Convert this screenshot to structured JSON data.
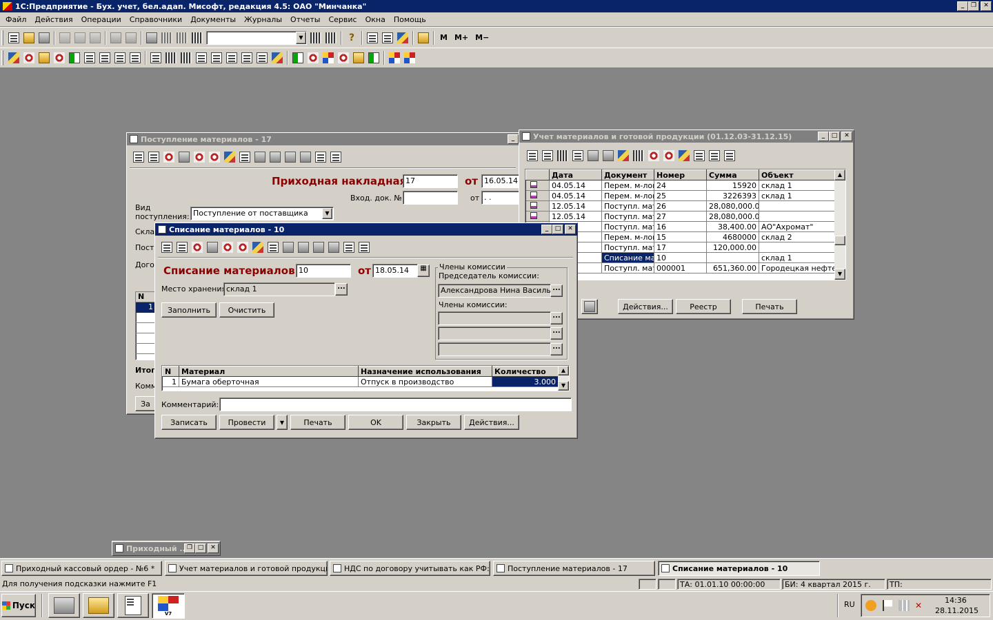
{
  "app": {
    "title": "1С:Предприятие - Бух. учет, бел.адап. Мисофт, редакция 4.5: ОАО \"Минчанка\"",
    "menu": [
      "Файл",
      "Действия",
      "Операции",
      "Справочники",
      "Документы",
      "Журналы",
      "Отчеты",
      "Сервис",
      "Окна",
      "Помощь"
    ],
    "toolbar_text": {
      "m": "M",
      "m_plus": "M+",
      "m_minus": "M−"
    }
  },
  "receipt_window": {
    "title": "Поступление материалов - 17",
    "heading": "Приходная накладная №",
    "number": "17",
    "from_label": "от",
    "date": "16.05.14",
    "incoming_doc_label": "Вход. док. №",
    "incoming_from_label": "от",
    "incoming_date": ". .",
    "kind_label_1": "Вид",
    "kind_label_2": "поступления:",
    "kind_value": "Поступление от поставщика",
    "sklad_label": "Скла",
    "post_label": "Пост",
    "dogo_label": "Дого",
    "n_header": "N",
    "row1": "1",
    "itog_label": "Итог",
    "komm_label": "Комм",
    "za_label": "За"
  },
  "journal_window": {
    "title": "Учет материалов и готовой продукции (01.12.03-31.12.15)",
    "columns": [
      "Дата",
      "Документ",
      "Номер",
      "Сумма",
      "Объект"
    ],
    "rows": [
      {
        "date": "04.05.14",
        "doc": "Перем. м-лов",
        "num": "24",
        "sum": "15920",
        "obj": "склад 1"
      },
      {
        "date": "04.05.14",
        "doc": "Перем. м-лов",
        "num": "25",
        "sum": "3226393",
        "obj": "склад 1"
      },
      {
        "date": "12.05.14",
        "doc": "Поступл. мате",
        "num": "26",
        "sum": "28,080,000.00",
        "obj": ""
      },
      {
        "date": "12.05.14",
        "doc": "Поступл. мате",
        "num": "27",
        "sum": "28,080,000.00",
        "obj": ""
      },
      {
        "date": "",
        "doc": "Поступл. мате",
        "num": "16",
        "sum": "38,400.00",
        "obj": "АО\"Ахромат\""
      },
      {
        "date": "",
        "doc": "Перем. м-лов",
        "num": "15",
        "sum": "4680000",
        "obj": "склад 2"
      },
      {
        "date": "",
        "doc": "Поступл. мате",
        "num": "17",
        "sum": "120,000.00",
        "obj": ""
      },
      {
        "date": "",
        "doc": "Списание мат",
        "num": "10",
        "sum": "",
        "obj": "склад 1"
      },
      {
        "date": "",
        "doc": "Поступл. мате",
        "num": "000001",
        "sum": "651,360.00",
        "obj": "Городецкая нефтеба"
      }
    ],
    "selected_row": 7,
    "buttons": {
      "actions": "Действия...",
      "registry": "Реестр",
      "print": "Печать"
    }
  },
  "writeoff_window": {
    "title": "Списание материалов - 10",
    "heading": "Списание материалов №",
    "number": "10",
    "from_label": "от",
    "date": "18.05.14",
    "storage_label": "Место хранения:",
    "storage_value": "склад 1",
    "fill_button": "Заполнить",
    "clear_button": "Очистить",
    "commission_group": "Члены комиссии",
    "chairman_label": "Председатель комиссии:",
    "chairman_value": "Александрова Нина Васильевн",
    "members_label": "Члены комиссии:",
    "table_columns": [
      "N",
      "Материал",
      "Назначение использования",
      "Количество"
    ],
    "table_rows": [
      {
        "n": "1",
        "material": "Бумага оберточная",
        "purpose": "Отпуск в производство",
        "qty": "3.000"
      }
    ],
    "comment_label": "Комментарий:",
    "comment_value": "",
    "buttons": {
      "save": "Записать",
      "post": "Провести",
      "print": "Печать",
      "ok": "OK",
      "close": "Закрыть",
      "actions": "Действия..."
    }
  },
  "minimized_window": {
    "title": "Приходный ..."
  },
  "taskbar_windows": [
    {
      "label": "Приходный кассовый ордер - №6 *"
    },
    {
      "label": "Учет материалов и готовой продукции..."
    },
    {
      "label": "НДС по договору учитывать как РФ:Г..."
    },
    {
      "label": "Поступление материалов - 17"
    },
    {
      "label": "Списание материалов - 10"
    }
  ],
  "status_bar": {
    "hint": "Для получения подсказки нажмите F1",
    "ta": "ТА: 01.01.10  00:00:00",
    "bi": "БИ: 4 квартал 2015 г.",
    "tp": "ТП:"
  },
  "os_taskbar": {
    "start": "Пуск",
    "v7_label": "V7",
    "lang": "RU",
    "time": "14:36",
    "date": "28.11.2015"
  }
}
